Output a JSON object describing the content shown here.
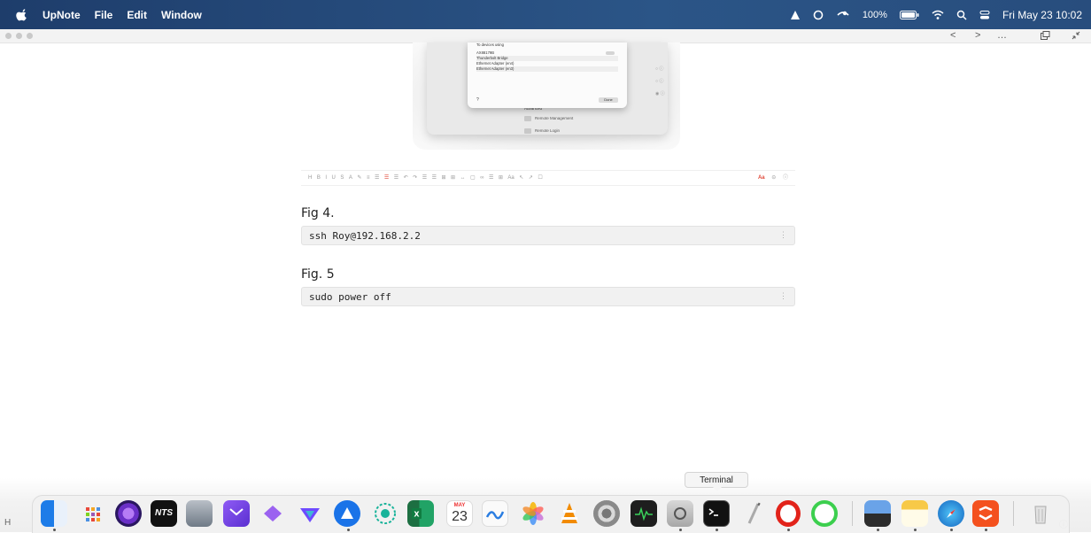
{
  "menubar": {
    "app_name": "UpNote",
    "menus": [
      "File",
      "Edit",
      "Window"
    ],
    "battery": "100%",
    "datetime": "Fri May 23  10:02"
  },
  "window_toolbar": {
    "back_label": "<",
    "forward_label": ">",
    "more_label": "…"
  },
  "embedded_screenshot": {
    "dialog_title": "To devices using",
    "rows": [
      "AX88179B",
      "Thunderbolt Bridge",
      "Ethernet Adapter (en4)",
      "Ethernet Adapter (en3)"
    ],
    "help_label": "?",
    "done_label": "Done",
    "section_label": "Advanced",
    "items": [
      "Remote Management",
      "Remote Login"
    ]
  },
  "format_toolbar": {
    "tools": [
      "H",
      "B",
      "I",
      "U",
      "S",
      "A",
      "✎",
      "≡",
      "☰",
      "☰",
      "☰",
      "↶",
      "↷",
      "☰",
      "☰",
      "⊞",
      "⊞",
      "↔",
      "▢",
      "∞",
      "☰",
      "⊞",
      "Aa",
      "↖",
      "↗",
      "☐"
    ],
    "right_tools": [
      "Aa",
      "⊝",
      "ⓘ"
    ]
  },
  "content": {
    "fig4_heading": "Fig 4.",
    "fig4_code": "ssh Roy@192.168.2.2",
    "fig5_heading": "Fig. 5",
    "fig5_code": "sudo power off"
  },
  "dock": {
    "tooltip": "Terminal",
    "calendar_month": "MAY",
    "calendar_day": "23",
    "apps": [
      "finder",
      "launchpad",
      "tor-browser",
      "nts-radio",
      "musescore",
      "mail",
      "craft",
      "proton-vpn",
      "teamviewer",
      "screen-sharing",
      "excel",
      "calendar",
      "freeform",
      "photos",
      "vlc",
      "system-settings",
      "activity-monitor",
      "disk-utility",
      "terminal",
      "textedit",
      "opera",
      "circle-app",
      "preview",
      "notes",
      "safari",
      "upnote",
      "trash"
    ]
  },
  "colors": {
    "menubar_bg": "#24477a",
    "code_bg": "#f1f1f1",
    "accent_red": "#e04a3a"
  }
}
